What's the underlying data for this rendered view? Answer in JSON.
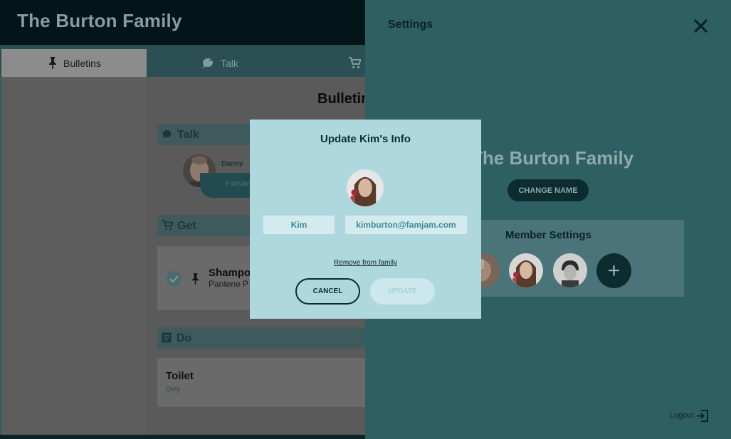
{
  "app": {
    "title": "The Burton Family"
  },
  "tabs": [
    {
      "label": "Bulletins",
      "icon": "pin-icon",
      "selected": true
    },
    {
      "label": "Talk",
      "icon": "chat-icon",
      "selected": false
    },
    {
      "label": "",
      "icon": "cart-icon",
      "selected": false
    }
  ],
  "main": {
    "title": "Bulletir",
    "talk": {
      "header": "Talk",
      "author": "Danny",
      "snippet": "FamJar"
    },
    "get": {
      "header": "Get",
      "item_title": "Shampo",
      "item_sub": "Pantene P"
    },
    "do": {
      "header": "Do",
      "item_title": "Toilet",
      "item_sub": "Dirty"
    }
  },
  "settings": {
    "title": "Settings",
    "family_name": "The Burton Family",
    "change_name_label": "CHANGE NAME",
    "member_settings_title": "Member Settings",
    "add_member_label": "+",
    "logout_label": "Logout"
  },
  "modal": {
    "title": "Update Kim's Info",
    "name_value": "Kim",
    "email_value": "kimburton@famjam.com",
    "remove_label": "Remove from family",
    "cancel_label": "CANCEL",
    "update_label": "UPDATE"
  },
  "colors": {
    "header_bg": "#021619",
    "panel_bg": "#2e5f63",
    "modal_bg": "#aed8de",
    "accent_dark": "#0d2c30",
    "field_text": "#3f8b94"
  }
}
